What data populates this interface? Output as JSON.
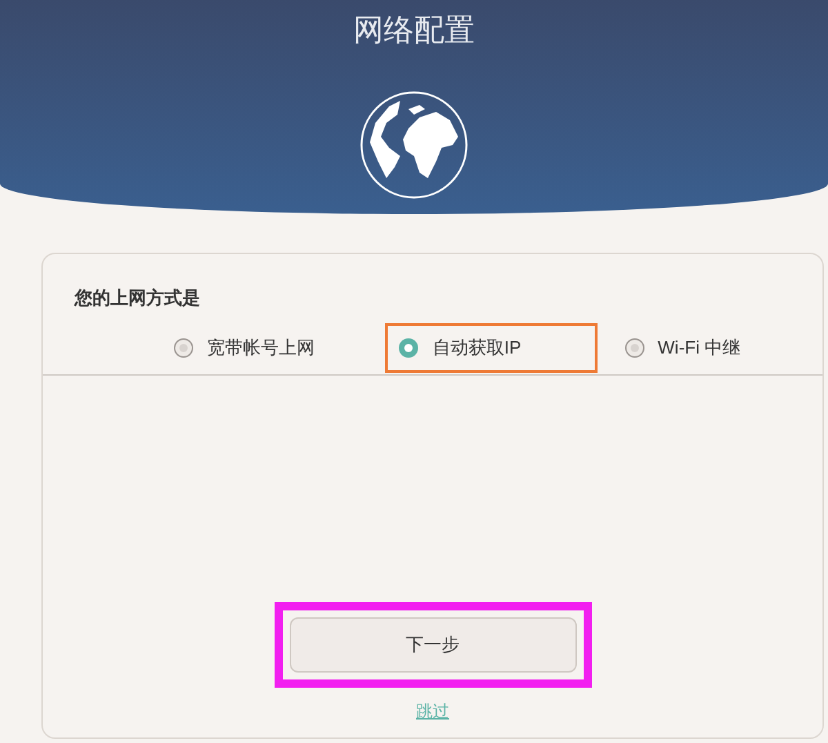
{
  "header": {
    "title": "网络配置"
  },
  "form": {
    "question": "您的上网方式是",
    "options": [
      {
        "label": "宽带帐号上网",
        "selected": false,
        "highlighted": false
      },
      {
        "label": "自动获取IP",
        "selected": true,
        "highlighted": true
      },
      {
        "label": "Wi-Fi 中继",
        "selected": false,
        "highlighted": false
      }
    ],
    "next_button": {
      "label": "下一步",
      "highlighted": true
    },
    "skip_link": "跳过"
  }
}
